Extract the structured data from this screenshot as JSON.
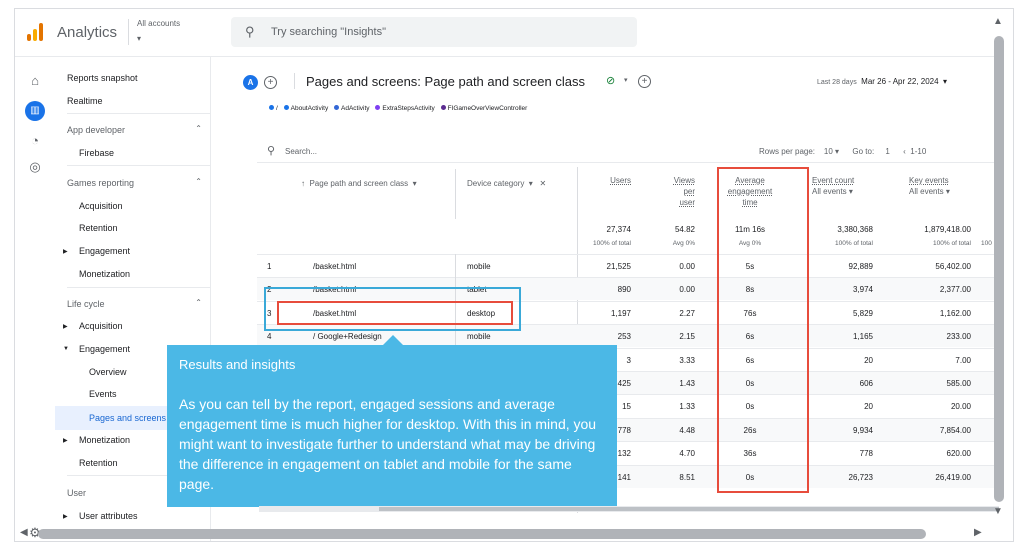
{
  "app": {
    "name": "Analytics",
    "account_label": "All accounts",
    "search_placeholder": "Try searching \"Insights\""
  },
  "nav": {
    "reports_snapshot": "Reports snapshot",
    "realtime": "Realtime",
    "app_developer": "App developer",
    "firebase": "Firebase",
    "games_reporting": "Games reporting",
    "gr_acquisition": "Acquisition",
    "gr_retention": "Retention",
    "gr_engagement": "Engagement",
    "gr_monetization": "Monetization",
    "life_cycle": "Life cycle",
    "lc_acquisition": "Acquisition",
    "lc_engagement": "Engagement",
    "overview": "Overview",
    "events": "Events",
    "pages_and_screens": "Pages and screens",
    "lc_monetization": "Monetization",
    "lc_retention": "Retention",
    "user": "User",
    "user_attributes": "User attributes"
  },
  "header": {
    "avatar_letter": "A",
    "title": "Pages and screens: Page path and screen class",
    "date_label": "Last 28 days",
    "date_range": "Mar 26 - Apr 22, 2024"
  },
  "legend": {
    "items": [
      {
        "label": "/",
        "color": "#1a73e8"
      },
      {
        "label": "AboutActivity",
        "color": "#1a73e8"
      },
      {
        "label": "AdActivity",
        "color": "#3367d6"
      },
      {
        "label": "ExtraStepsActivity",
        "color": "#7e3ff2"
      },
      {
        "label": "FIGameOverViewController",
        "color": "#5c2d91"
      }
    ]
  },
  "table": {
    "search_placeholder": "Search...",
    "rows_per_page_label": "Rows per page:",
    "rows_per_page_value": "10",
    "goto_label": "Go to:",
    "goto_value": "1",
    "page_range": "1-10",
    "col_dim1": "Page path and screen class",
    "col_dim2": "Device category",
    "col_users": "Users",
    "col_views_per_user_1": "Views",
    "col_views_per_user_2": "per",
    "col_views_per_user_3": "user",
    "col_avg_eng_1": "Average",
    "col_avg_eng_2": "engagement",
    "col_avg_eng_3": "time",
    "col_event_count": "Event count",
    "col_event_count_sub": "All events",
    "col_key_events": "Key events",
    "col_key_events_sub": "All events",
    "totals": {
      "users": "27,374",
      "users_sub": "100% of total",
      "views": "54.82",
      "views_sub": "Avg 0%",
      "avg": "11m 16s",
      "avg_sub": "Avg 0%",
      "events": "3,380,368",
      "events_sub": "100% of total",
      "key": "1,879,418.00",
      "key_sub": "100% of total",
      "extra_sub": "100"
    },
    "rows": [
      {
        "n": "1",
        "path": "/basket.html",
        "device": "mobile",
        "users": "21,525",
        "views": "0.00",
        "avg": "5s",
        "events": "92,889",
        "key": "56,402.00"
      },
      {
        "n": "2",
        "path": "/basket.html",
        "device": "tablet",
        "users": "890",
        "views": "0.00",
        "avg": "8s",
        "events": "3,974",
        "key": "2,377.00"
      },
      {
        "n": "3",
        "path": "/basket.html",
        "device": "desktop",
        "users": "1,197",
        "views": "2.27",
        "avg": "76s",
        "events": "5,829",
        "key": "1,162.00"
      },
      {
        "n": "4",
        "path": "/ Google+Redesign",
        "device": "mobile",
        "users": "253",
        "views": "2.15",
        "avg": "6s",
        "events": "1,165",
        "key": "233.00"
      },
      {
        "n": "5",
        "path": "",
        "device": "",
        "users": "3",
        "views": "3.33",
        "avg": "6s",
        "events": "20",
        "key": "7.00"
      },
      {
        "n": "6",
        "path": "",
        "device": "",
        "users": "425",
        "views": "1.43",
        "avg": "0s",
        "events": "606",
        "key": "585.00"
      },
      {
        "n": "7",
        "path": "",
        "device": "",
        "users": "15",
        "views": "1.33",
        "avg": "0s",
        "events": "20",
        "key": "20.00"
      },
      {
        "n": "8",
        "path": "",
        "device": "",
        "users": "778",
        "views": "4.48",
        "avg": "26s",
        "events": "9,934",
        "key": "7,854.00"
      },
      {
        "n": "9",
        "path": "",
        "device": "",
        "users": "132",
        "views": "4.70",
        "avg": "36s",
        "events": "778",
        "key": "620.00"
      },
      {
        "n": "10",
        "path": "",
        "device": "",
        "users": "141",
        "views": "8.51",
        "avg": "0s",
        "events": "26,723",
        "key": "26,419.00"
      }
    ]
  },
  "callout": {
    "heading": "Results and insights",
    "body": "As you can tell by the report, engaged sessions and average engagement time is much higher for desktop. With this in mind, you might want to investigate further to understand what may be driving the difference in engagement on tablet and mobile for the same page."
  },
  "colors": {
    "accent": "#1a73e8",
    "callout": "#4bb8e6",
    "highlight_red": "#e74c3c",
    "highlight_blue": "#3aa9d8"
  }
}
